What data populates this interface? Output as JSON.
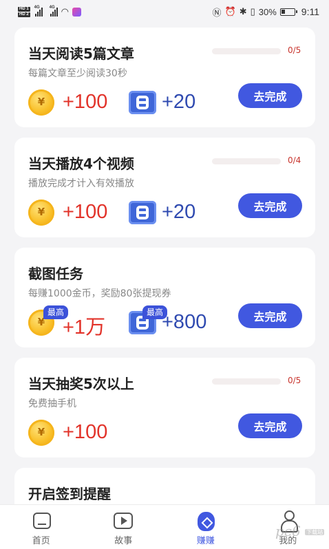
{
  "status_bar": {
    "hd1": "HD 1",
    "hd2": "HD 2",
    "net1": "4G",
    "net2": "4G",
    "battery_pct": "30%",
    "time": "9:11"
  },
  "tasks": [
    {
      "title": "当天阅读5篇文章",
      "subtitle": "每篇文章至少阅读30秒",
      "progress_text": "0/5",
      "progress": 0,
      "coin_reward": "+100",
      "ticket_reward": "+20",
      "button": "去完成"
    },
    {
      "title": "当天播放4个视频",
      "subtitle": "播放完成才计入有效播放",
      "progress_text": "0/4",
      "progress": 0,
      "coin_reward": "+100",
      "ticket_reward": "+20",
      "button": "去完成"
    },
    {
      "title": "截图任务",
      "subtitle": "每赚1000金币，奖励80张提现券",
      "coin_tag": "最高",
      "coin_reward": "+1万",
      "ticket_tag": "最高",
      "ticket_reward": "+800",
      "button": "去完成"
    },
    {
      "title": "当天抽奖5次以上",
      "subtitle": "免费抽手机",
      "progress_text": "0/5",
      "progress": 0,
      "coin_reward": "+100",
      "button": "去完成"
    },
    {
      "title": "开启签到提醒"
    }
  ],
  "bottom_nav": [
    {
      "label": "首页",
      "icon": "home-icon"
    },
    {
      "label": "故事",
      "icon": "play-icon"
    },
    {
      "label": "赚赚",
      "icon": "earn-icon",
      "active": true
    },
    {
      "label": "我的",
      "icon": "profile-icon"
    }
  ],
  "watermark": {
    "text": "pc6",
    "badge": "下载站"
  },
  "colors": {
    "accent": "#4158e0",
    "reward_red": "#e2332a",
    "ticket_blue": "#2f4ab0",
    "background": "#f4f4f6"
  }
}
